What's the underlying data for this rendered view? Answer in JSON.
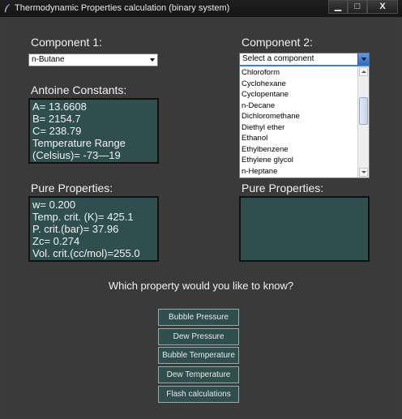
{
  "window": {
    "title": "Thermodynamic Properties calculation (binary system)",
    "controls": {
      "minimize": "▁",
      "maximize": "□",
      "close": "X"
    }
  },
  "component1": {
    "label": "Component 1:",
    "selected": "n-Butane"
  },
  "component2": {
    "label": "Component 2:",
    "selected": "Select a component",
    "options": [
      "Chloroform",
      "Cyclohexane",
      "Cyclopentane",
      "n-Decane",
      "Dichloromethane",
      "Diethyl ether",
      "Ethanol",
      "Ethylbenzene",
      "Ethylene glycol",
      "n-Heptane"
    ]
  },
  "antoine": {
    "label": "Antoine Constants:",
    "lines": [
      "A= 13.6608",
      "B= 2154.7",
      "C= 238.79",
      "Temperature Range",
      "(Celsius)= -73—19"
    ]
  },
  "pure1": {
    "label": "Pure Properties:",
    "lines": [
      "w= 0.200",
      "Temp. crit. (K)= 425.1",
      "P. crit.(bar)= 37.96",
      "Zc= 0.274",
      "Vol. crit.(cc/mol)=255.0"
    ]
  },
  "pure2": {
    "label": "Pure Properties:"
  },
  "question": "Which property would you like to know?",
  "buttons": [
    "Bubble Pressure",
    "Dew Pressure",
    "Bubble Temperature",
    "Dew Temperature",
    "Flash calculations"
  ],
  "colors": {
    "panel": "#2f4f4f",
    "background": "#3a3a3a",
    "text": "#f2f2f2"
  }
}
